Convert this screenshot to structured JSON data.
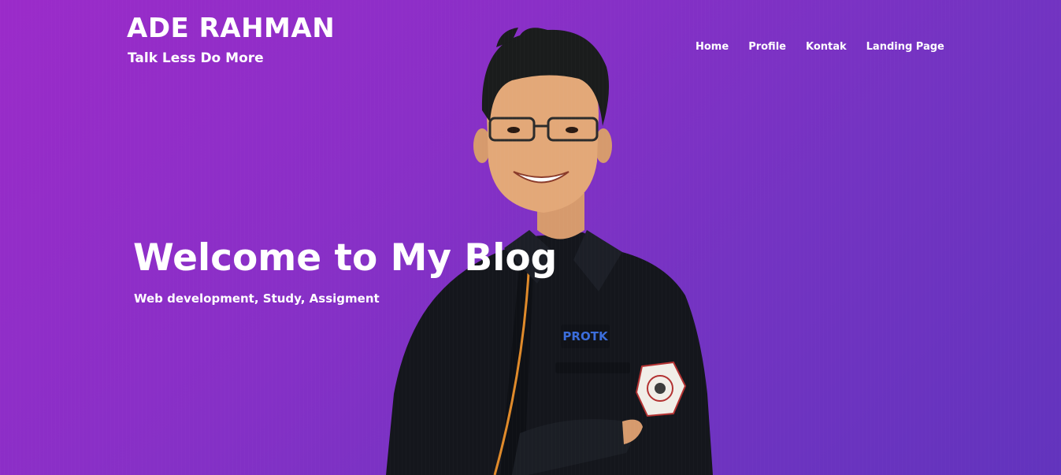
{
  "brand": {
    "name": "ADE RAHMAN",
    "tagline": "Talk Less Do More"
  },
  "nav": {
    "items": [
      {
        "label": "Home"
      },
      {
        "label": "Profile"
      },
      {
        "label": "Kontak"
      },
      {
        "label": "Landing Page"
      }
    ]
  },
  "hero": {
    "heading": "Welcome to My Blog",
    "subheading": "Web development, Study, Assigment",
    "badge_text": "PROTK",
    "background_colors": [
      "#9b2bc9",
      "#6233bd"
    ],
    "jacket_color": "#14161c",
    "accent_piping_color": "#e08a2a"
  }
}
